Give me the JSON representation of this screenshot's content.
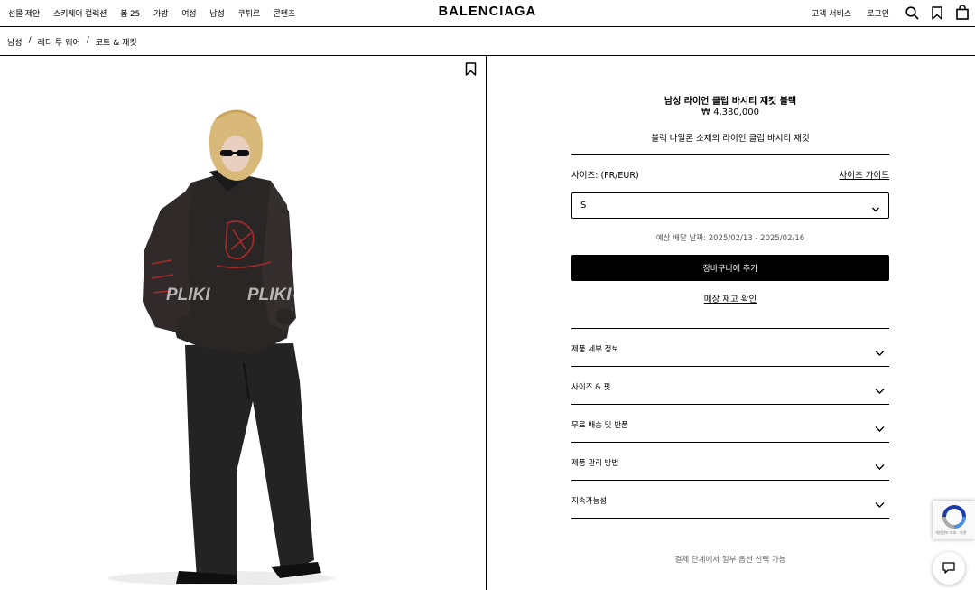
{
  "header": {
    "nav_left": [
      "선물 제안",
      "스키웨어 컬렉션",
      "봄 25",
      "가방",
      "여성",
      "남성",
      "쿠튀르",
      "콘텐츠"
    ],
    "brand": "BALENCIAGA",
    "nav_right": [
      "고객 서비스",
      "로그인"
    ],
    "icons": [
      "search-icon",
      "bookmark-icon",
      "shopping-bag-icon"
    ]
  },
  "breadcrumb": [
    "남성",
    "레디 투 웨어",
    "코트 & 재킷"
  ],
  "breadcrumb_sep": "/",
  "image": {
    "watermark": "PLIKI"
  },
  "product": {
    "title": "남성 라이언 클럽 바시티 재킷 블랙",
    "price": "₩ 4,380,000",
    "description": "블랙 나일론 소재의 라이언 클럽 바시티 재킷",
    "size_label": "사이즈: (FR/EUR)",
    "size_guide": "사이즈 가이드",
    "size_selected": "S",
    "delivery": "예상 배달 날짜: 2025/02/13 - 2025/02/16",
    "add_to_cart": "장바구니에 추가",
    "store_stock": "매장 재고 확인",
    "accordion": [
      "제품 세부 정보",
      "사이즈 & 핏",
      "무료 배송 및 반품",
      "제품 관리 방법",
      "지속가능성"
    ],
    "payment_note": "결제 단계에서 일부 옵션 선택 가능"
  },
  "widgets": {
    "recaptcha_caption": "개인정보 보호 · 약관"
  }
}
